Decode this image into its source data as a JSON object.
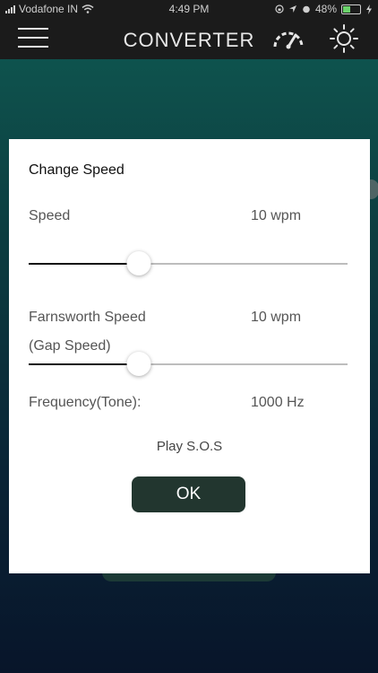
{
  "status_bar": {
    "carrier": "Vodafone IN",
    "time": "4:49 PM",
    "battery": "48%",
    "battery_level": 0.48
  },
  "nav": {
    "title": "CONVERTER",
    "icons": [
      "menu-icon",
      "speedometer-icon",
      "brightness-icon"
    ]
  },
  "dialog": {
    "title": "Change Speed",
    "speed": {
      "label": "Speed",
      "value": "10 wpm",
      "slider_level": 0.345
    },
    "farnsworth": {
      "label": "Farnsworth Speed",
      "sublabel": "(Gap Speed)",
      "value": "10 wpm",
      "slider_level": 0.345
    },
    "frequency": {
      "label": "Frequency(Tone):",
      "value": "1000 Hz"
    },
    "play_label": "Play S.O.S",
    "ok_label": "OK"
  },
  "colors": {
    "accent": "#22362f",
    "bar": "#1b1b1b",
    "bg_top": "#0f5a52",
    "bg_bottom": "#08152a"
  }
}
